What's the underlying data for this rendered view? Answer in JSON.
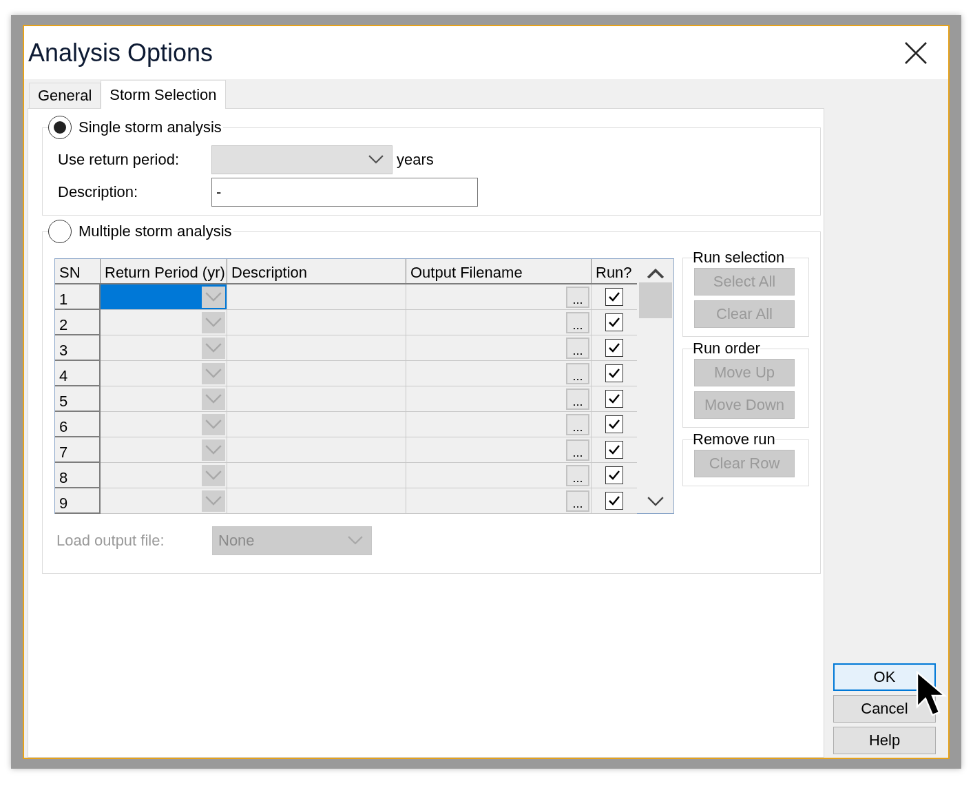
{
  "window": {
    "title": "Analysis Options"
  },
  "tabs": [
    {
      "label": "General",
      "selected": false
    },
    {
      "label": "Storm Selection",
      "selected": true
    }
  ],
  "single": {
    "label": "Single storm analysis",
    "selected": true,
    "return_period_label": "Use return period:",
    "return_period_unit": "years",
    "description_label": "Description:",
    "description_value": "-"
  },
  "multiple": {
    "label": "Multiple storm analysis",
    "selected": false,
    "columns": [
      "SN",
      "Return Period (yr)",
      "Description",
      "Output Filename",
      "Run?"
    ],
    "rows": [
      {
        "sn": "1",
        "browse": "...",
        "run": true,
        "selected": true
      },
      {
        "sn": "2",
        "browse": "...",
        "run": true,
        "selected": false
      },
      {
        "sn": "3",
        "browse": "...",
        "run": true,
        "selected": false
      },
      {
        "sn": "4",
        "browse": "...",
        "run": true,
        "selected": false
      },
      {
        "sn": "5",
        "browse": "...",
        "run": true,
        "selected": false
      },
      {
        "sn": "6",
        "browse": "...",
        "run": true,
        "selected": false
      },
      {
        "sn": "7",
        "browse": "...",
        "run": true,
        "selected": false
      },
      {
        "sn": "8",
        "browse": "...",
        "run": true,
        "selected": false
      },
      {
        "sn": "9",
        "browse": "...",
        "run": true,
        "selected": false
      }
    ],
    "groups": [
      {
        "title": "Run selection",
        "buttons": [
          {
            "label": "Select All",
            "disabled": true
          },
          {
            "label": "Clear All",
            "disabled": true
          }
        ]
      },
      {
        "title": "Run order",
        "buttons": [
          {
            "label": "Move Up",
            "disabled": true
          },
          {
            "label": "Move Down",
            "disabled": true
          }
        ]
      },
      {
        "title": "Remove run",
        "buttons": [
          {
            "label": "Clear Row",
            "disabled": true
          }
        ]
      }
    ],
    "load_label": "Load output file:",
    "load_value": "None",
    "load_disabled": true
  },
  "buttons": [
    {
      "label": "OK",
      "kind": "default"
    },
    {
      "label": "Cancel",
      "kind": "normal"
    },
    {
      "label": "Help",
      "kind": "normal"
    }
  ]
}
